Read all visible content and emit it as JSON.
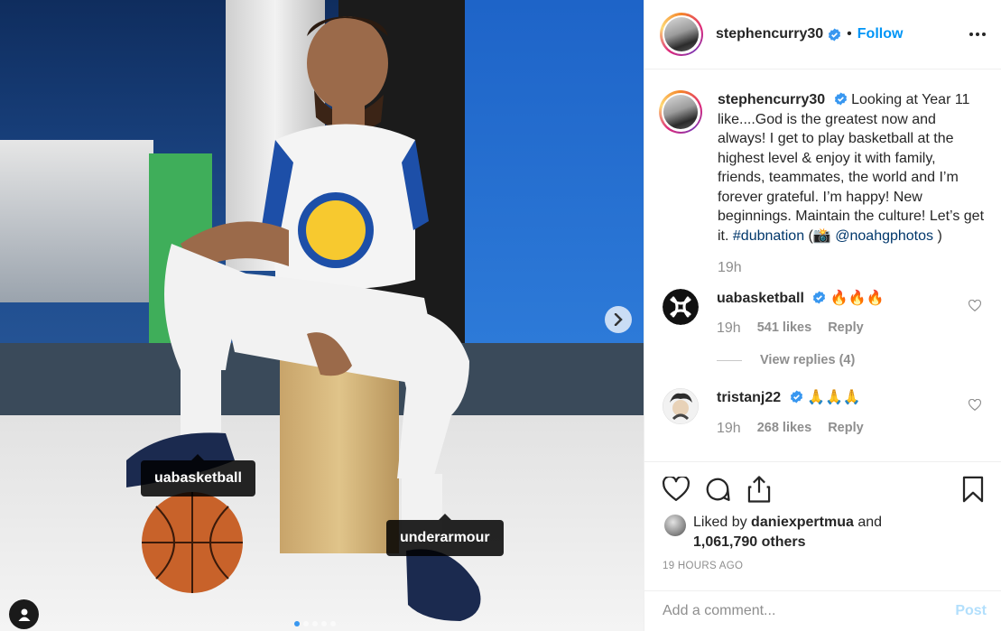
{
  "photo": {
    "tags": [
      "uabasketball",
      "underarmour"
    ],
    "carousel": {
      "count": 5,
      "active": 0
    }
  },
  "header": {
    "username": "stephencurry30",
    "separator": "•",
    "follow_label": "Follow"
  },
  "caption": {
    "username": "stephencurry30",
    "text": "Looking at Year 11 like....God is the greatest now and always! I get to play basketball at the highest level & enjoy it with family, friends, teammates, the world and I’m forever grateful. I’m happy! New beginnings. Maintain the culture! Let’s get it.",
    "hashtag": "#dubnation",
    "credit_open": "(📸",
    "credit_mention": "@noahgphotos",
    "credit_close": ")",
    "time": "19h"
  },
  "comments": [
    {
      "username": "uabasketball",
      "text": "🔥🔥🔥",
      "time": "19h",
      "likes": "541 likes",
      "reply": "Reply",
      "view_replies": "View replies (4)"
    },
    {
      "username": "tristanj22",
      "text": "🙏🙏🙏",
      "time": "19h",
      "likes": "268 likes",
      "reply": "Reply"
    }
  ],
  "likes": {
    "prefix": "Liked by",
    "user": "daniexpertmua",
    "and": "and",
    "count": "1,061,790 others"
  },
  "timestamp": "19 HOURS AGO",
  "add_comment": {
    "placeholder": "Add a comment...",
    "post_label": "Post"
  },
  "colors": {
    "accent": "#0095f6",
    "link": "#00376b",
    "muted": "#8e8e8e",
    "verified": "#3897f0"
  }
}
